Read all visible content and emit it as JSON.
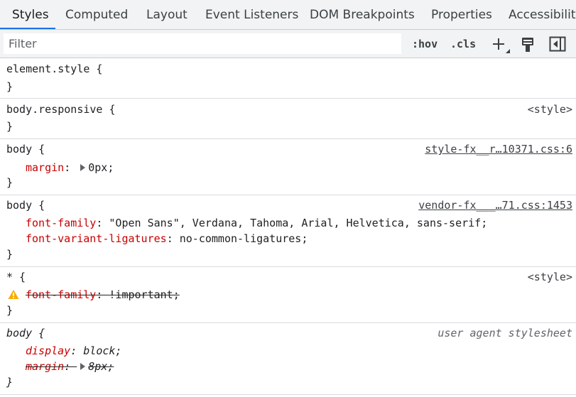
{
  "tabs": [
    {
      "label": "Styles"
    },
    {
      "label": "Computed"
    },
    {
      "label": "Layout"
    },
    {
      "label": "Event Listeners"
    },
    {
      "label": "DOM Breakpoints"
    },
    {
      "label": "Properties"
    },
    {
      "label": "Accessibility"
    }
  ],
  "toolbar": {
    "filter_placeholder": "Filter",
    "hov_label": ":hov",
    "cls_label": ".cls",
    "icons": [
      "plus-icon",
      "paint-brush-icon",
      "sidebar-toggle-icon"
    ]
  },
  "rules": [
    {
      "selector": "element.style {",
      "close": "}"
    },
    {
      "selector": "body.responsive {",
      "source": "<style>",
      "close": "}"
    },
    {
      "selector": "body {",
      "source": "style-fx__r…10371.css:6",
      "close": "}",
      "props": [
        {
          "name": "margin",
          "sep": ": ",
          "value": "0px;"
        }
      ]
    },
    {
      "selector": "body {",
      "source": "vendor-fx___…71.css:1453",
      "close": "}",
      "props": [
        {
          "name": "font-family",
          "sep": ": ",
          "value": "\"Open Sans\", Verdana, Tahoma, Arial, Helvetica, sans-serif;"
        },
        {
          "name": "font-variant-ligatures",
          "sep": ": ",
          "value": "no-common-ligatures;"
        }
      ]
    },
    {
      "selector": "* {",
      "source": "<style>",
      "close": "}",
      "props": [
        {
          "name": "font-family",
          "sep": ": ",
          "value": "!important;"
        }
      ]
    },
    {
      "selector": "body {",
      "source": "user agent stylesheet",
      "close": "}",
      "props": [
        {
          "name": "display",
          "sep": ": ",
          "value": "block;"
        },
        {
          "name": "margin",
          "sep": ": ",
          "value": "8px;"
        }
      ]
    }
  ],
  "colors": {
    "accent": "#1a73e8",
    "property_name": "#c80000",
    "warning": "#f9ab00"
  }
}
